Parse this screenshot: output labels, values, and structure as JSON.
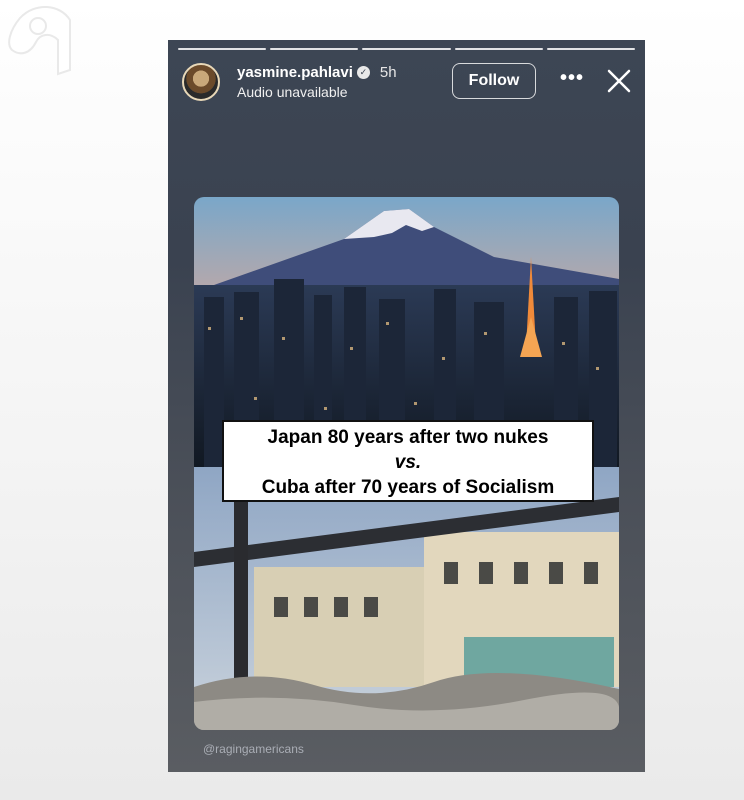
{
  "story": {
    "username": "yasmine.pahlavi",
    "time": "5h",
    "audio_status": "Audio unavailable",
    "follow_label": "Follow",
    "progress_segments": 5
  },
  "post": {
    "caption_line1": "Japan 80 years after two nukes",
    "caption_line2": "vs.",
    "caption_line3": "Cuba after 70 years of Socialism"
  },
  "watermark": "@ragingamericans",
  "icons": {
    "verified": "verified-badge-icon",
    "more": "more-options-icon",
    "close": "close-icon",
    "logo": "corner-logo-icon"
  },
  "colors": {
    "story_bg": "#3d4654",
    "caption_bg": "#ffffff",
    "page_bg": "#ffffff"
  }
}
